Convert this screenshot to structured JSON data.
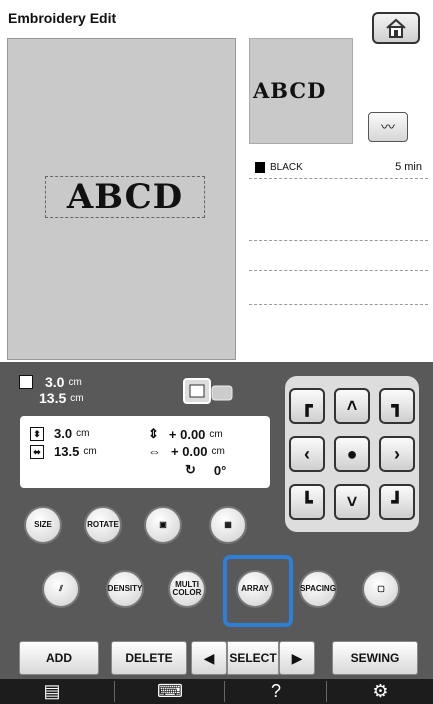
{
  "title": "Embroidery Edit",
  "icons": {
    "home": "home-icon",
    "stitch": "stitch-view-icon",
    "frame": "embroidery-frame-icon"
  },
  "design": {
    "canvas_text": "ABCD",
    "preview_text": "ABCD"
  },
  "colors": [
    {
      "name": "BLACK",
      "time": "5 min",
      "swatch": "#000000"
    }
  ],
  "info": {
    "height": "3.0",
    "width": "13.5",
    "unit": "cm",
    "h_box": "3.0",
    "w_box": "13.5",
    "v_offset": "+ 0.00",
    "h_offset": "+ 0.00",
    "rotation": "0°"
  },
  "buttons": {
    "size": "SIZE",
    "rotate": "ROTATE",
    "density": "DENSITY",
    "multi_color": "MULTI COLOR",
    "array": "ARRAY",
    "spacing": "SPACING",
    "add": "ADD",
    "delete": "DELETE",
    "select": "SELECT",
    "sewing": "SEWING"
  },
  "accent": "#2d7fd8"
}
